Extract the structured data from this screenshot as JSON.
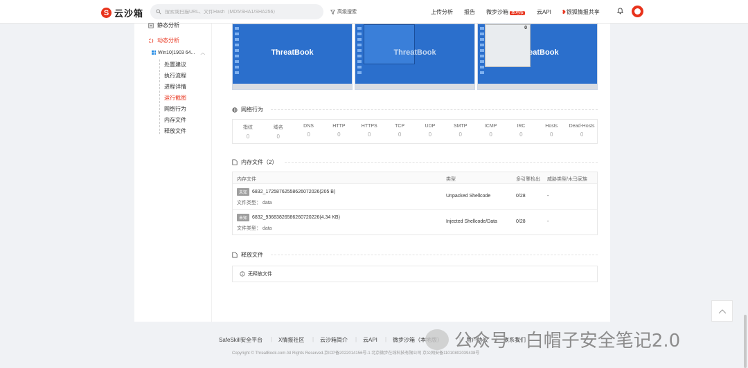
{
  "header": {
    "logo_text": "云沙箱",
    "search_placeholder": "搜索或扫描URL、文件Hash（MD5/SHA1/SHA256）",
    "advanced_search": "高级搜索",
    "nav": {
      "upload_analysis": "上传分析",
      "report": "报告",
      "sandbox": "微步沙箱",
      "sandbox_badge": "本地版",
      "cloud_api": "云API",
      "intel_share": "银狐情报共享"
    }
  },
  "sidebar": {
    "static_analysis": "静态分析",
    "dynamic_analysis": "动态分析",
    "os_env": "Win10(1903 64...",
    "items": [
      "处置建议",
      "执行流程",
      "进程详情",
      "运行截图",
      "网络行为",
      "内存文件",
      "释放文件"
    ],
    "active_item": "运行截图"
  },
  "screenshots": {
    "brand": "ThreatBook",
    "calc_display": "0"
  },
  "network": {
    "title": "网络行为",
    "columns": [
      {
        "label": "指纹",
        "value": "0"
      },
      {
        "label": "域名",
        "value": "0"
      },
      {
        "label": "DNS",
        "value": "0"
      },
      {
        "label": "HTTP",
        "value": "0"
      },
      {
        "label": "HTTPS",
        "value": "0"
      },
      {
        "label": "TCP",
        "value": "0"
      },
      {
        "label": "UDP",
        "value": "0"
      },
      {
        "label": "SMTP",
        "value": "0"
      },
      {
        "label": "ICMP",
        "value": "0"
      },
      {
        "label": "IRC",
        "value": "0"
      },
      {
        "label": "Hosts",
        "value": "0"
      },
      {
        "label": "Dead-Hosts",
        "value": "0"
      }
    ]
  },
  "memory_files": {
    "title": "内存文件（2）",
    "headers": {
      "file": "内存文件",
      "type": "类型",
      "engines": "多引擎检出",
      "threat": "威胁类型/木马家族"
    },
    "rows": [
      {
        "tag": "未知",
        "name": "6832_17258762558626072026(205 B)",
        "file_type_label": "文件类型：",
        "file_type": "data",
        "type": "Unpacked Shellcode",
        "engines": "0/28",
        "threat": "-"
      },
      {
        "tag": "未知",
        "name": "6832_93683826586260720226(4.34 KB)",
        "file_type_label": "文件类型：",
        "file_type": "data",
        "type": "Injected Shellcode/Data",
        "engines": "0/28",
        "threat": "-"
      }
    ]
  },
  "released_files": {
    "title": "释放文件",
    "empty_text": "无释放文件"
  },
  "footer": {
    "links": [
      "SafeSkill安全平台",
      "X情报社区",
      "云沙箱简介",
      "云API",
      "微步沙箱（本地版）",
      "用户协议",
      "联系我们"
    ],
    "copyright": "Copyright © ThreatBook.com All Rights Reserved.京ICP备2022014156号-1 北京微步在线科技有限公司 京公网安备11010802039438号"
  },
  "watermark": {
    "text": "公众号 · 白帽子安全笔记2.0"
  },
  "colors": {
    "accent": "#e8331c",
    "desktop": "#2b6fcc"
  }
}
